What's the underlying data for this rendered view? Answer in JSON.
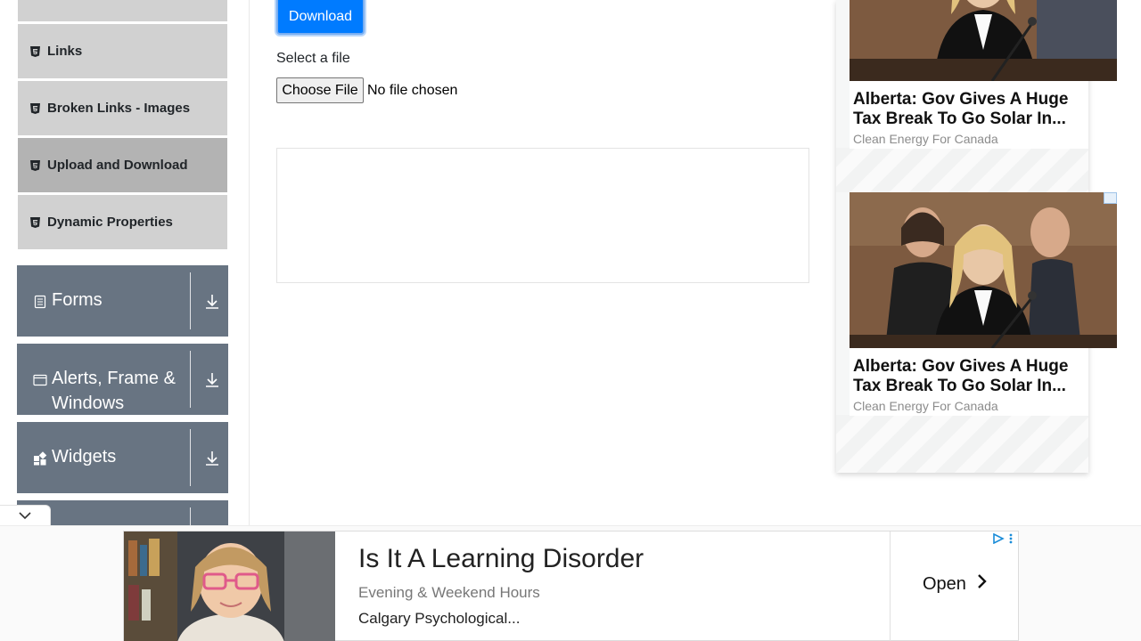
{
  "sidebar": {
    "items": [
      {
        "label": "Links"
      },
      {
        "label": "Broken Links - Images"
      },
      {
        "label": "Upload and Download"
      },
      {
        "label": "Dynamic Properties"
      }
    ],
    "groups": [
      {
        "label": "Forms",
        "icon": "document-icon"
      },
      {
        "label_line1": "Alerts, Frame &",
        "label_line2": "Windows",
        "icon": "window-icon"
      },
      {
        "label": "Widgets",
        "icon": "widgets-icon"
      }
    ]
  },
  "main": {
    "download_label": "Download",
    "select_file_label": "Select a file",
    "choose_file_label": "Choose File",
    "no_file_text": "No file chosen"
  },
  "side_ads": [
    {
      "headline": "Alberta: Gov Gives A Huge Tax Break To Go Solar In...",
      "source": "Clean Energy For Canada"
    },
    {
      "headline": "Alberta: Gov Gives A Huge Tax Break To Go Solar In...",
      "source": "Clean Energy For Canada"
    }
  ],
  "banner_ad": {
    "title": "Is It A Learning Disorder",
    "subtitle": "Evening & Weekend Hours",
    "advertiser": "Calgary Psychological...",
    "cta": "Open"
  },
  "colors": {
    "accent": "#007bff",
    "menu_item_bg": "#d1d1d1",
    "menu_item_active_bg": "#b3b3b3",
    "group_bg": "#687482"
  }
}
